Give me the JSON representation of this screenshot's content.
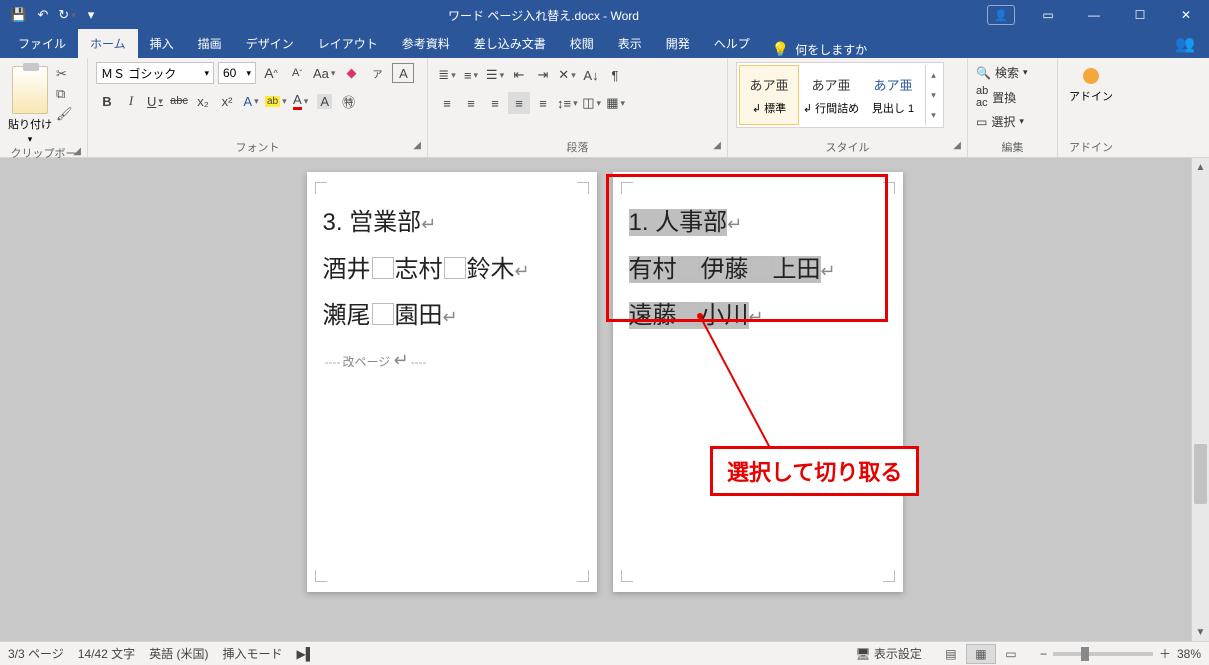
{
  "title": "ワード ページ入れ替え.docx - Word",
  "qat": {
    "save": "save",
    "undo": "undo",
    "redo": "redo"
  },
  "tabs": {
    "file": "ファイル",
    "home": "ホーム",
    "insert": "挿入",
    "draw": "描画",
    "design": "デザイン",
    "layout": "レイアウト",
    "references": "参考資料",
    "mailings": "差し込み文書",
    "review": "校閲",
    "view": "表示",
    "developer": "開発",
    "help": "ヘルプ",
    "tell_me": "何をしますか"
  },
  "ribbon": {
    "clipboard": {
      "paste": "貼り付け",
      "label": "クリップボード"
    },
    "font": {
      "name": "ＭＳ ゴシック",
      "size": "60",
      "label": "フォント",
      "grow": "A",
      "shrink": "A",
      "case": "Aa",
      "clear": "A",
      "ruby": "ア",
      "charborder": "A",
      "bold": "B",
      "italic": "I",
      "underline": "U",
      "strike": "abc",
      "sub": "x₂",
      "sup": "x²",
      "effects": "A",
      "highlight": "ab",
      "fontcolor": "A",
      "charshade": "A",
      "enclose": "㊕"
    },
    "paragraph": {
      "label": "段落"
    },
    "styles": {
      "label": "スタイル",
      "items": [
        {
          "preview": "あア亜",
          "name": "↲ 標準"
        },
        {
          "preview": "あア亜",
          "name": "↲ 行間詰め"
        },
        {
          "preview": "あア亜",
          "name": "見出し 1"
        }
      ]
    },
    "editing": {
      "find": "検索",
      "replace": "置換",
      "select": "選択",
      "label": "編集"
    },
    "addin": {
      "label": "アドイン",
      "btn": "アドイン"
    }
  },
  "document": {
    "page_left": {
      "line1": "3. 営業部",
      "line2_names": [
        "酒井",
        "志村",
        "鈴木"
      ],
      "line3_names": [
        "瀬尾",
        "園田"
      ],
      "pagebreak": "改ページ"
    },
    "page_right": {
      "line1": "1. 人事部",
      "line2_names": [
        "有村",
        "伊藤",
        "上田"
      ],
      "line3_names": [
        "遠藤",
        "小川"
      ]
    }
  },
  "annotation": {
    "callout": "選択して切り取る"
  },
  "status": {
    "page": "3/3 ページ",
    "words": "14/42 文字",
    "lang": "英語 (米国)",
    "mode": "挿入モード",
    "display_settings": "表示設定",
    "zoom": "38%"
  }
}
